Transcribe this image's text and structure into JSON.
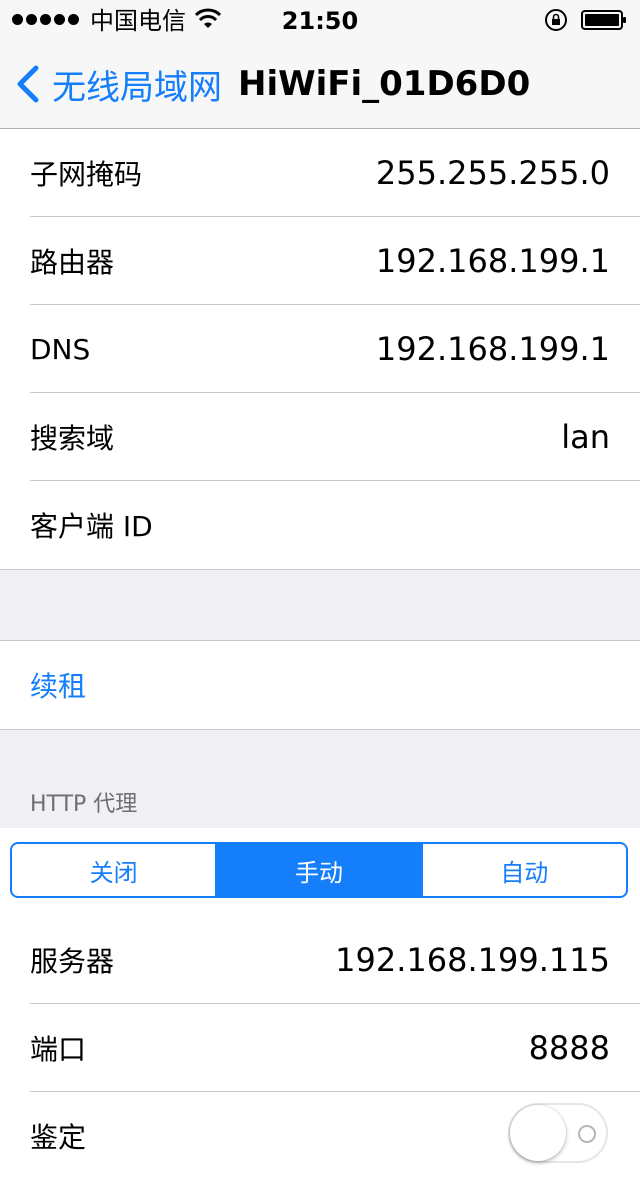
{
  "status_bar": {
    "carrier": "中国电信",
    "time": "21:50"
  },
  "nav": {
    "back_label": "无线局域网",
    "title": "HiWiFi_01D6D0"
  },
  "network_info": [
    {
      "label": "子网掩码",
      "value": "255.255.255.0"
    },
    {
      "label": "路由器",
      "value": "192.168.199.1"
    },
    {
      "label": "DNS",
      "value": "192.168.199.1"
    },
    {
      "label": "搜索域",
      "value": "lan"
    },
    {
      "label": "客户端 ID",
      "value": ""
    }
  ],
  "renew_lease": {
    "label": "续租"
  },
  "http_proxy": {
    "header": "HTTP 代理",
    "modes": [
      {
        "label": "关闭"
      },
      {
        "label": "手动"
      },
      {
        "label": "自动"
      }
    ],
    "selected_mode": "手动",
    "fields": [
      {
        "label": "服务器",
        "value": "192.168.199.115"
      },
      {
        "label": "端口",
        "value": "8888"
      }
    ],
    "auth": {
      "label": "鉴定",
      "enabled": false
    }
  },
  "colors": {
    "accent": "#147efb",
    "background": "#efeff4",
    "separator": "#c8c7cc"
  },
  "icons": [
    "signal-dots-icon",
    "wifi-icon",
    "orientation-lock-icon",
    "battery-icon",
    "back-chevron-icon"
  ]
}
